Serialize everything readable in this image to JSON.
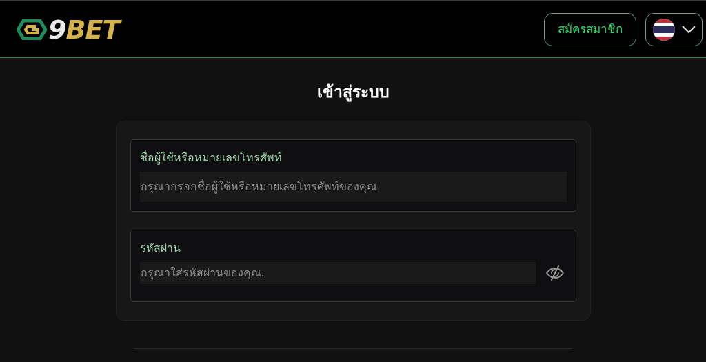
{
  "header": {
    "logo": {
      "number": "9",
      "word": "BET"
    },
    "register_button": "สมัครสมาชิก",
    "language": {
      "kind": "flag"
    }
  },
  "title": "เข้าสู่ระบบ",
  "fields": [
    {
      "kind": "text",
      "label": "ชื่อผู้ใช้หรือหมายเลขโทรศัพท์",
      "placeholder": "กรุณากรอกชื่อผู้ใช้หรือหมายเลขโทรศัพท์ของคุณ"
    },
    {
      "kind": "password",
      "label": "รหัสผ่าน",
      "placeholder": "กรุณาใส่รหัสผ่านของคุณ."
    }
  ]
}
